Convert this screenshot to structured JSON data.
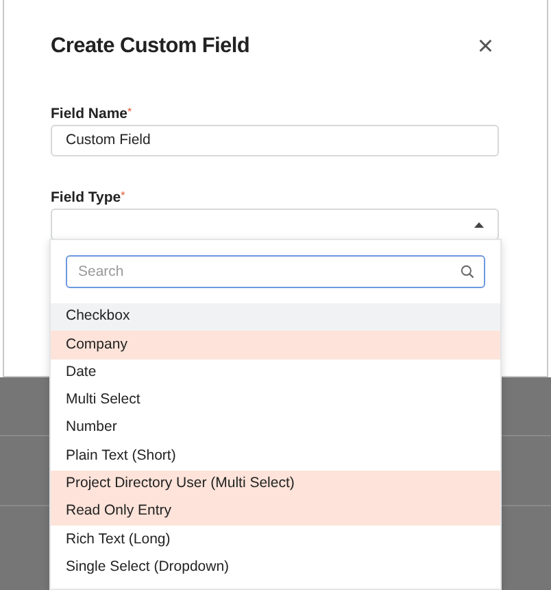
{
  "dialog": {
    "title": "Create Custom Field",
    "close": "×"
  },
  "fields": [
    {
      "label": "Field Name",
      "required_mark": "*",
      "value": "Custom Field"
    },
    {
      "label": "Field Type",
      "required_mark": "*",
      "expanded": true
    }
  ],
  "dropdown": {
    "search": {
      "placeholder": "Search"
    },
    "options": [
      {
        "label": "Checkbox",
        "hovered": true,
        "highlighted": false
      },
      {
        "label": "Company",
        "hovered": false,
        "highlighted": true
      },
      {
        "label": "Date",
        "hovered": false,
        "highlighted": false
      },
      {
        "label": "Multi Select",
        "hovered": false,
        "highlighted": false
      },
      {
        "label": "Number",
        "hovered": false,
        "highlighted": false
      },
      {
        "label": "Plain Text (Short)",
        "hovered": false,
        "highlighted": false
      },
      {
        "label": "Project Directory User (Multi Select)",
        "hovered": false,
        "highlighted": true
      },
      {
        "label": "Read Only Entry",
        "hovered": false,
        "highlighted": true
      },
      {
        "label": "Rich Text (Long)",
        "hovered": false,
        "highlighted": false
      },
      {
        "label": "Single Select (Dropdown)",
        "hovered": false,
        "highlighted": false
      }
    ]
  }
}
